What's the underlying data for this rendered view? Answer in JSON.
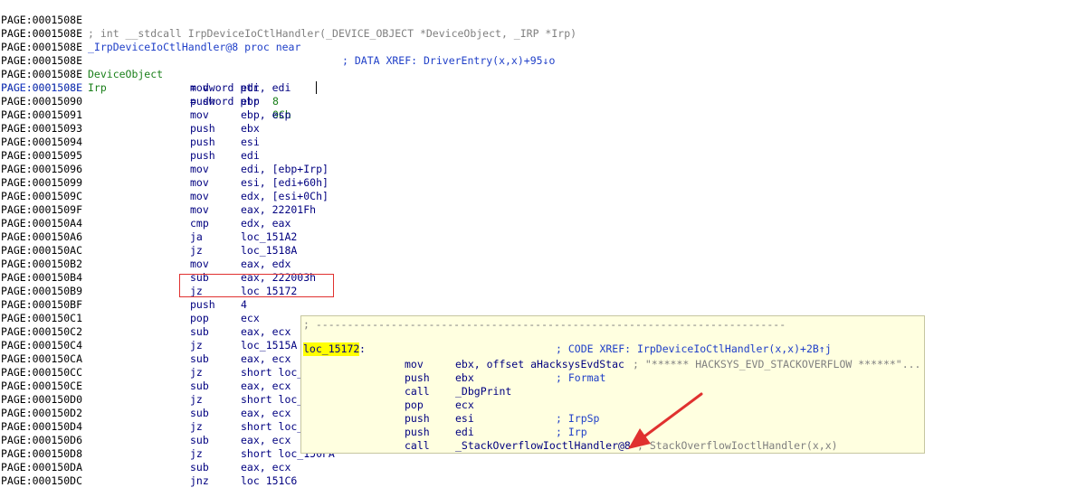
{
  "header": {
    "line0_addr": "PAGE:0001508E",
    "line0_comment": "; int __stdcall IrpDeviceIoCtlHandler(_DEVICE_OBJECT *DeviceObject, _IRP *Irp)",
    "line1_addr": "PAGE:0001508E",
    "line1_func": "_IrpDeviceIoCtlHandler@8 proc near",
    "line1_xref": "; DATA XREF: DriverEntry(x,x)+95↓o"
  },
  "blank_addr": "PAGE:0001508E",
  "vars": [
    {
      "addr": "PAGE:0001508E",
      "name": "DeviceObject",
      "def": "= dword ptr",
      "val": "8"
    },
    {
      "addr": "PAGE:0001508E",
      "name": "Irp",
      "def": "= dword ptr",
      "val": "0Ch"
    }
  ],
  "instructions": [
    {
      "addr": "PAGE:0001508E",
      "mn": "mov",
      "op": "edi, edi",
      "addr_blue": true
    },
    {
      "addr": "PAGE:00015090",
      "mn": "push",
      "op": "ebp"
    },
    {
      "addr": "PAGE:00015091",
      "mn": "mov",
      "op": "ebp, esp"
    },
    {
      "addr": "PAGE:00015093",
      "mn": "push",
      "op": "ebx"
    },
    {
      "addr": "PAGE:00015094",
      "mn": "push",
      "op": "esi"
    },
    {
      "addr": "PAGE:00015095",
      "mn": "push",
      "op": "edi"
    },
    {
      "addr": "PAGE:00015096",
      "mn": "mov",
      "op": "edi, [ebp+Irp]"
    },
    {
      "addr": "PAGE:00015099",
      "mn": "mov",
      "op": "esi, [edi+60h]"
    },
    {
      "addr": "PAGE:0001509C",
      "mn": "mov",
      "op": "edx, [esi+0Ch]"
    },
    {
      "addr": "PAGE:0001509F",
      "mn": "mov",
      "op": "eax, 22201Fh"
    },
    {
      "addr": "PAGE:000150A4",
      "mn": "cmp",
      "op": "edx, eax"
    },
    {
      "addr": "PAGE:000150A6",
      "mn": "ja",
      "op": "loc_151A2"
    },
    {
      "addr": "PAGE:000150AC",
      "mn": "jz",
      "op": "loc_1518A"
    },
    {
      "addr": "PAGE:000150B2",
      "mn": "mov",
      "op": "eax, edx"
    },
    {
      "addr": "PAGE:000150B4",
      "mn": "sub",
      "op": "eax, 222003h"
    },
    {
      "addr": "PAGE:000150B9",
      "mn": "jz",
      "op": "loc 15172"
    },
    {
      "addr": "PAGE:000150BF",
      "mn": "push",
      "op": "4"
    },
    {
      "addr": "PAGE:000150C1",
      "mn": "pop",
      "op": "ecx"
    },
    {
      "addr": "PAGE:000150C2",
      "mn": "sub",
      "op": "eax, ecx"
    },
    {
      "addr": "PAGE:000150C4",
      "mn": "jz",
      "op": "loc_1515A"
    },
    {
      "addr": "PAGE:000150CA",
      "mn": "sub",
      "op": "eax, ecx"
    },
    {
      "addr": "PAGE:000150CC",
      "mn": "jz",
      "op": "short loc_"
    },
    {
      "addr": "PAGE:000150CE",
      "mn": "sub",
      "op": "eax, ecx"
    },
    {
      "addr": "PAGE:000150D0",
      "mn": "jz",
      "op": "short loc_"
    },
    {
      "addr": "PAGE:000150D2",
      "mn": "sub",
      "op": "eax, ecx"
    },
    {
      "addr": "PAGE:000150D4",
      "mn": "jz",
      "op": "short loc_"
    },
    {
      "addr": "PAGE:000150D6",
      "mn": "sub",
      "op": "eax, ecx"
    },
    {
      "addr": "PAGE:000150D8",
      "mn": "jz",
      "op": "short loc_150FA"
    },
    {
      "addr": "PAGE:000150DA",
      "mn": "sub",
      "op": "eax, ecx"
    },
    {
      "addr": "PAGE:000150DC",
      "mn": "jnz",
      "op": "loc 151C6"
    }
  ],
  "popup": {
    "separator": "; ---------------------------------------------------------------------------",
    "label": "loc_15172",
    "label_colon": ":",
    "xref": "; CODE XREF: IrpDeviceIoCtlHandler(x,x)+2B↑j",
    "lines": [
      {
        "mn": "mov",
        "op": "ebx, offset aHacksysEvdStac",
        "cm": "",
        "str": "; \"****** HACKSYS_EVD_STACKOVERFLOW ******\"..."
      },
      {
        "mn": "push",
        "op": "ebx",
        "cm": "; Format",
        "str": ""
      },
      {
        "mn": "call",
        "op": "_DbgPrint",
        "cm": "",
        "str": ""
      },
      {
        "mn": "pop",
        "op": "ecx",
        "cm": "",
        "str": ""
      },
      {
        "mn": "push",
        "op": "esi",
        "cm": "; IrpSp",
        "str": ""
      },
      {
        "mn": "push",
        "op": "edi",
        "cm": "; Irp",
        "str": ""
      },
      {
        "mn": "call",
        "op": "_StackOverflowIoctlHandler@8",
        "cm": "",
        "str": "; StackOverflowIoctlHandler(x,x)"
      }
    ]
  },
  "colors": {
    "address": "#000000",
    "highlight_address": "#1f3fc8",
    "mnemonic": "#000080",
    "variable": "#1a7f1a",
    "popup_bg": "#ffffe0",
    "label_highlight": "#ffff00",
    "annotation_red": "#e0312f"
  }
}
